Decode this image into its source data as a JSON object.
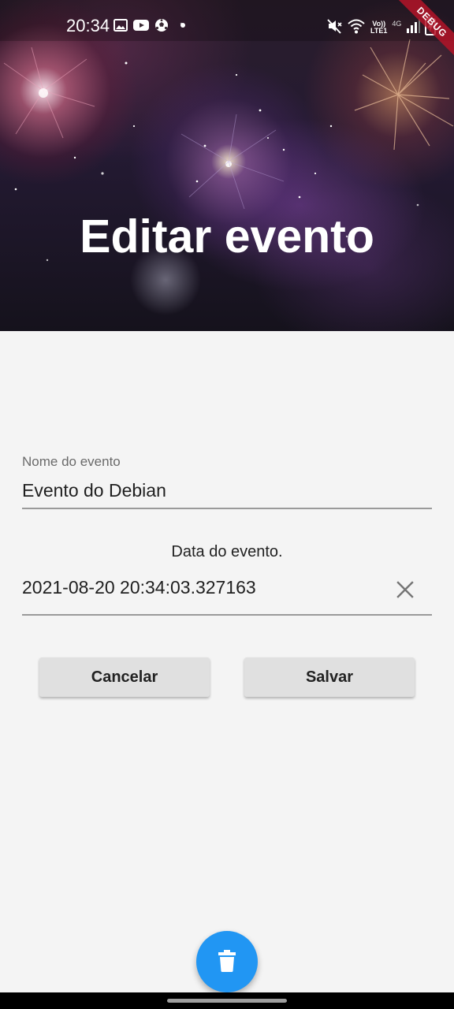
{
  "status_bar": {
    "time": "20:34",
    "left_icons": [
      "image-icon",
      "youtube-icon",
      "soccer-ball-icon",
      "dot-icon"
    ],
    "right_icons": [
      "mute-icon",
      "wifi-icon",
      "volte-icon",
      "signal-icon",
      "battery-charging-icon"
    ],
    "network_label_top": "Vo))",
    "network_label_bottom": "LTE1",
    "network_type": "4G"
  },
  "debug_banner": "DEBUG",
  "header": {
    "title": "Editar evento"
  },
  "form": {
    "name_field": {
      "label": "Nome do evento",
      "value": "Evento do Debian"
    },
    "date_field": {
      "caption": "Data do evento.",
      "value": "2021-08-20 20:34:03.327163",
      "clear_icon": "close-icon"
    },
    "buttons": {
      "cancel_label": "Cancelar",
      "save_label": "Salvar"
    }
  },
  "fab": {
    "icon": "trash-icon",
    "color": "#2196f3"
  },
  "colors": {
    "background": "#f4f4f4",
    "button_background": "#e0e0e0",
    "underline": "#9a9a9a",
    "accent": "#2196f3"
  }
}
